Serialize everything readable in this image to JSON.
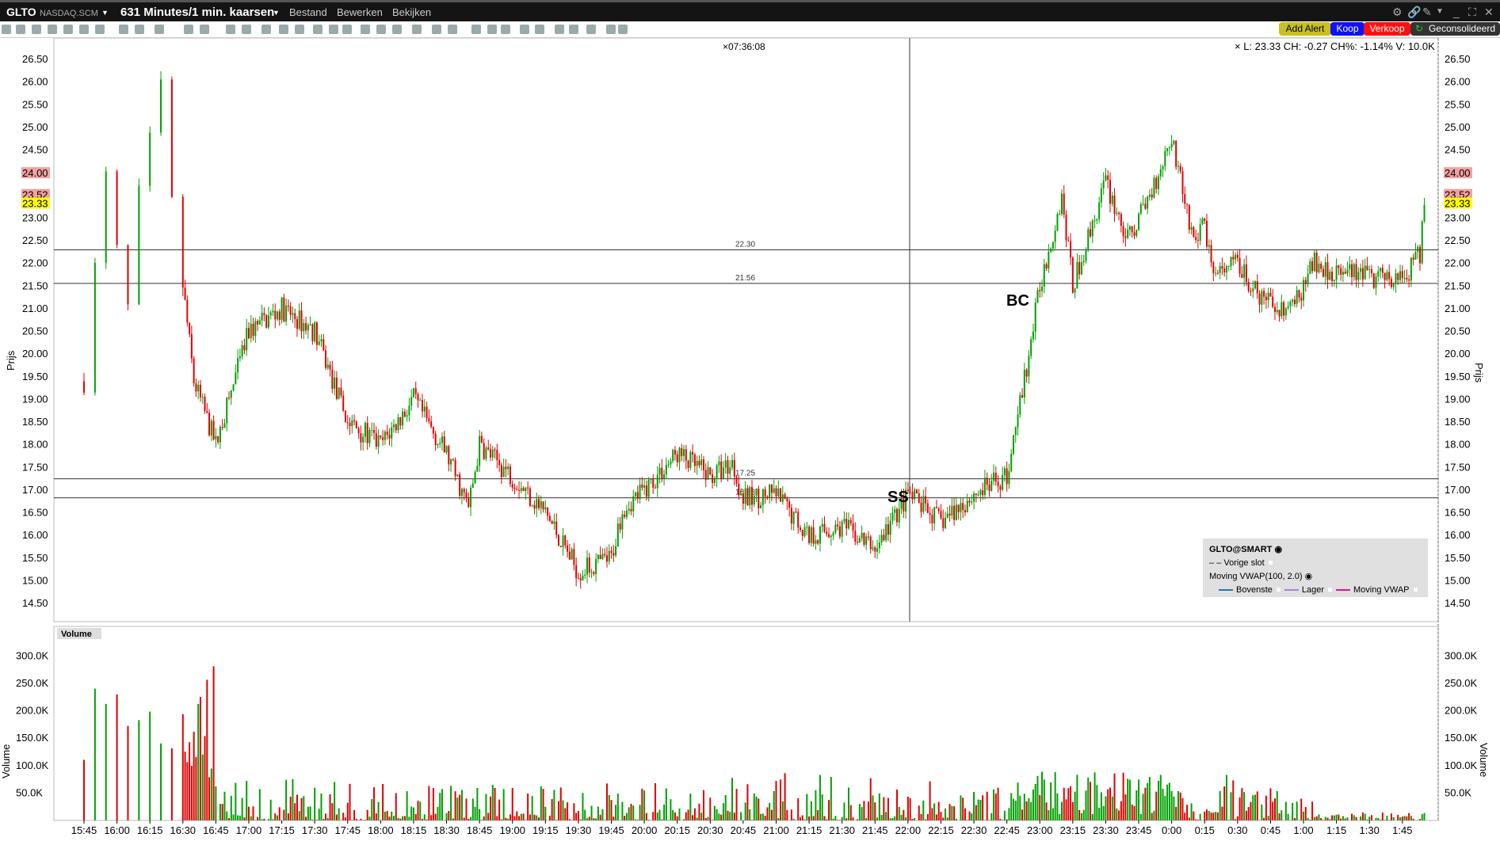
{
  "window": {
    "symbol": "GLTO",
    "exchange": "NASDAQ.SCM",
    "timeframe": "631 Minutes/1 min. kaarsen",
    "menus": [
      "Bestand",
      "Bewerken",
      "Bekijken"
    ]
  },
  "buttons": {
    "add_alert": "Add Alert",
    "buy": "Koop",
    "sell": "Verkoop",
    "consolidated": "Geconsolideerd"
  },
  "colors": {
    "up": "#00a000",
    "down": "#e00000",
    "add_alert": "#c8c020",
    "buy": "#1010ff",
    "sell": "#ff1010"
  },
  "crosshair": {
    "time": "07:36:08"
  },
  "info": "L: 23.33 CH: -0.27 CH%: -1.14% V: 10.0K",
  "price_axis": {
    "title": "Prijs",
    "ticks": [
      "26.50",
      "26.00",
      "25.50",
      "25.00",
      "24.50",
      "24.00",
      "23.50",
      "23.00",
      "22.50",
      "22.00",
      "21.50",
      "21.00",
      "20.50",
      "20.00",
      "19.50",
      "19.00",
      "18.50",
      "18.00",
      "17.50",
      "17.00",
      "16.50",
      "16.00",
      "15.50",
      "15.00",
      "14.50"
    ],
    "markers": [
      {
        "label": "24.00",
        "value": 24.0,
        "color": "#f4a0a0"
      },
      {
        "label": "23.52",
        "value": 23.52,
        "color": "#f4a0a0"
      },
      {
        "label": "23.33",
        "value": 23.33,
        "color": "#ffff00"
      }
    ]
  },
  "levels": [
    {
      "label": "22.30",
      "value": 22.3
    },
    {
      "label": "21.56",
      "value": 21.56
    },
    {
      "label": "17.25",
      "value": 17.25
    },
    {
      "label": "16.83",
      "value": 16.83
    }
  ],
  "annotations": [
    {
      "text": "BC"
    },
    {
      "text": "SS"
    }
  ],
  "volume_axis": {
    "title": "Volume",
    "pane_label": "Volume",
    "ticks": [
      "300.0K",
      "250.0K",
      "200.0K",
      "150.0K",
      "100.0K",
      "50.0K"
    ]
  },
  "time_axis": [
    "15:45",
    "16:00",
    "16:15",
    "16:30",
    "16:45",
    "17:00",
    "17:15",
    "17:30",
    "17:45",
    "18:00",
    "18:15",
    "18:30",
    "18:45",
    "19:00",
    "19:15",
    "19:30",
    "19:45",
    "20:00",
    "20:15",
    "20:30",
    "20:45",
    "21:00",
    "21:15",
    "21:30",
    "21:45",
    "22:00",
    "22:15",
    "22:30",
    "22:45",
    "23:00",
    "23:15",
    "23:30",
    "23:45",
    "0:00",
    "0:15",
    "0:30",
    "0:45",
    "1:00",
    "1:15",
    "1:30",
    "1:45"
  ],
  "legend": {
    "title": "GLTO@SMART",
    "prev_close": "Vorige slot",
    "study": "Moving VWAP(100, 2.0)",
    "upper": "Bovenste",
    "lower": "Lager",
    "vwap": "Moving VWAP",
    "upper_color": "#1a7ac0",
    "lower_color": "#b080e0",
    "vwap_color": "#e0109a"
  },
  "price_path": [
    [
      0,
      19.4
    ],
    [
      4,
      21.5
    ],
    [
      10,
      23.9
    ],
    [
      14,
      22.5
    ],
    [
      20,
      21
    ],
    [
      25,
      23.5
    ],
    [
      35,
      25.85
    ],
    [
      40,
      23.3
    ],
    [
      45,
      21.5
    ],
    [
      50,
      19.4
    ],
    [
      60,
      18
    ],
    [
      75,
      20.5
    ],
    [
      90,
      21
    ],
    [
      105,
      20.5
    ],
    [
      120,
      18.5
    ],
    [
      135,
      18
    ],
    [
      150,
      19
    ],
    [
      165,
      17.8
    ],
    [
      175,
      16.6
    ],
    [
      180,
      18
    ],
    [
      195,
      17.3
    ],
    [
      210,
      16.5
    ],
    [
      225,
      15.2
    ],
    [
      240,
      15.5
    ],
    [
      245,
      16.6
    ],
    [
      255,
      17
    ],
    [
      270,
      17.8
    ],
    [
      285,
      17.3
    ],
    [
      295,
      17.6
    ],
    [
      300,
      16.8
    ],
    [
      315,
      16.9
    ],
    [
      330,
      16
    ],
    [
      345,
      16.2
    ],
    [
      360,
      15.7
    ],
    [
      375,
      16.9
    ],
    [
      390,
      16.3
    ],
    [
      405,
      16.9
    ],
    [
      420,
      17.3
    ],
    [
      430,
      20
    ],
    [
      435,
      21.5
    ],
    [
      445,
      23.5
    ],
    [
      450,
      21.5
    ],
    [
      465,
      23.8
    ],
    [
      475,
      22.5
    ],
    [
      485,
      23.5
    ],
    [
      495,
      24.8
    ],
    [
      505,
      22.5
    ],
    [
      510,
      22.8
    ],
    [
      515,
      21.7
    ],
    [
      525,
      22
    ],
    [
      535,
      21.2
    ],
    [
      550,
      21
    ],
    [
      560,
      22
    ],
    [
      570,
      21.8
    ],
    [
      600,
      21.6
    ],
    [
      608,
      22.2
    ],
    [
      610,
      23.33
    ]
  ]
}
